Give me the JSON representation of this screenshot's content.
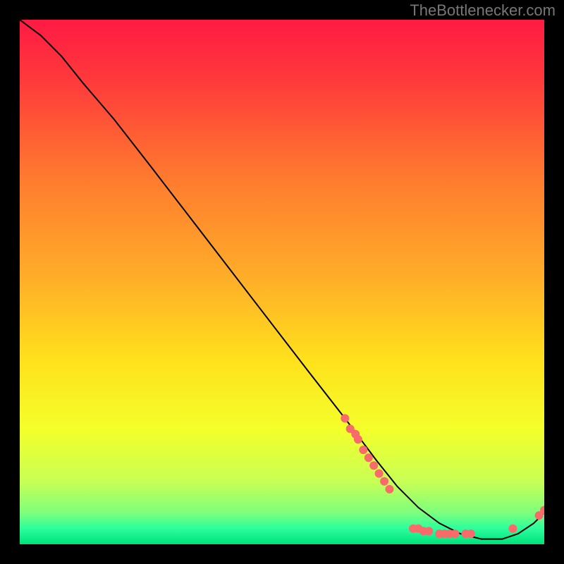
{
  "attribution": "TheBottlenecker.com",
  "chart_data": {
    "type": "line",
    "title": "",
    "xlabel": "",
    "ylabel": "",
    "xlim": [
      0,
      100
    ],
    "ylim": [
      0,
      100
    ],
    "background_gradient": {
      "stops": [
        {
          "offset": 0.0,
          "color": "#ff1a44"
        },
        {
          "offset": 0.12,
          "color": "#ff3b3b"
        },
        {
          "offset": 0.3,
          "color": "#ff7a2f"
        },
        {
          "offset": 0.5,
          "color": "#ffb028"
        },
        {
          "offset": 0.65,
          "color": "#ffe11c"
        },
        {
          "offset": 0.78,
          "color": "#f4ff2a"
        },
        {
          "offset": 0.88,
          "color": "#c8ff54"
        },
        {
          "offset": 0.94,
          "color": "#7dff7d"
        },
        {
          "offset": 0.97,
          "color": "#2bff9d"
        },
        {
          "offset": 1.0,
          "color": "#00e07a"
        }
      ]
    },
    "series": [
      {
        "name": "bottleneck-curve",
        "x": [
          0,
          4,
          8,
          12,
          18,
          25,
          35,
          45,
          55,
          62,
          68,
          72,
          76,
          80,
          84,
          88,
          92,
          95,
          98,
          100
        ],
        "y": [
          100,
          97,
          93,
          88,
          81,
          72,
          59,
          46,
          33,
          24,
          16,
          11,
          7,
          4,
          2,
          1,
          1,
          2,
          4,
          6
        ]
      }
    ],
    "markers": {
      "name": "data-points",
      "color": "#f96a6a",
      "points": [
        {
          "x": 62,
          "y": 24
        },
        {
          "x": 63,
          "y": 22
        },
        {
          "x": 64,
          "y": 21
        },
        {
          "x": 64.5,
          "y": 20
        },
        {
          "x": 65.5,
          "y": 18
        },
        {
          "x": 66.5,
          "y": 16.5
        },
        {
          "x": 67.5,
          "y": 15
        },
        {
          "x": 68.5,
          "y": 13.5
        },
        {
          "x": 69.5,
          "y": 12
        },
        {
          "x": 70.5,
          "y": 10.5
        },
        {
          "x": 75,
          "y": 3
        },
        {
          "x": 76,
          "y": 3
        },
        {
          "x": 77,
          "y": 2.5
        },
        {
          "x": 78,
          "y": 2.5
        },
        {
          "x": 80,
          "y": 2
        },
        {
          "x": 81,
          "y": 2
        },
        {
          "x": 82,
          "y": 2
        },
        {
          "x": 83,
          "y": 2
        },
        {
          "x": 85,
          "y": 2
        },
        {
          "x": 86,
          "y": 2
        },
        {
          "x": 94,
          "y": 3
        },
        {
          "x": 99,
          "y": 5.5
        },
        {
          "x": 100,
          "y": 6.5
        }
      ]
    }
  }
}
